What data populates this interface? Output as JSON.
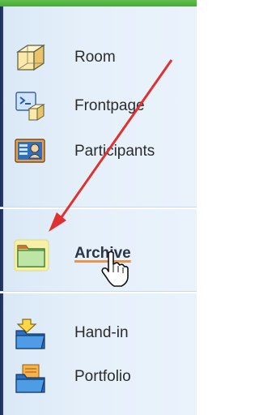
{
  "sidebar": {
    "items": [
      {
        "label": "Room",
        "icon": "cube-icon"
      },
      {
        "label": "Frontpage",
        "icon": "frontpage-icon"
      },
      {
        "label": "Participants",
        "icon": "participants-icon"
      },
      {
        "label": "Archive",
        "icon": "archive-folder-icon",
        "active": true
      },
      {
        "label": "Hand-in",
        "icon": "hand-in-folder-icon"
      },
      {
        "label": "Portfolio",
        "icon": "portfolio-folder-icon"
      }
    ]
  },
  "colors": {
    "top_bar": "#4aa53b",
    "active_underline": "#e8954e",
    "arrow": "#e03030"
  }
}
